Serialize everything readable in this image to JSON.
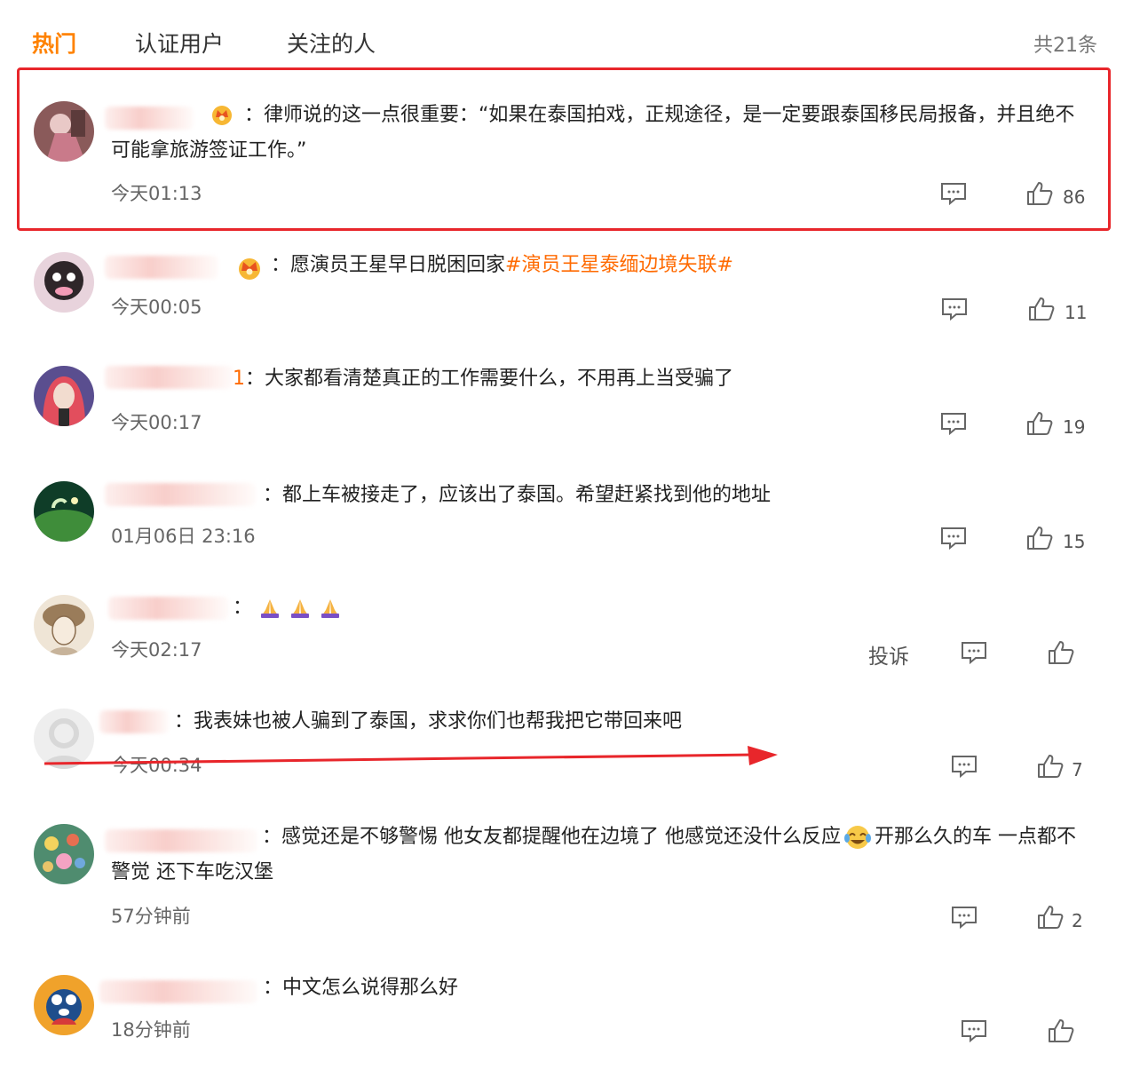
{
  "tabs": [
    {
      "label": "热门",
      "active": true
    },
    {
      "label": "认证用户",
      "active": false
    },
    {
      "label": "关注的人",
      "active": false
    }
  ],
  "total": "共21条",
  "comments": [
    {
      "colon": "：",
      "text": "律师说的这一点很重要：“如果在泰国拍戏，正规途径，是一定要跟泰国移民局报备，并且绝不可能拿旅游签证工作。”",
      "time": "今天01:13",
      "likes": "86"
    },
    {
      "colon": "：",
      "text": "愿演员王星早日脱困回家",
      "hashtag": "#演员王星泰缅边境失联#",
      "time": "今天00:05",
      "likes": "11"
    },
    {
      "name_tail": "1",
      "colon": "：",
      "text": "大家都看清楚真正的工作需要什么，不用再上当受骗了",
      "time": "今天00:17",
      "likes": "19"
    },
    {
      "colon": "：",
      "text": "都上车被接走了，应该出了泰国。希望赶紧找到他的地址",
      "time": "01月06日 23:16",
      "likes": "15"
    },
    {
      "colon": "：",
      "text": "",
      "emoji": "folded-hands-emoji",
      "time": "今天02:17",
      "likes": "",
      "report": "投诉"
    },
    {
      "colon": "：",
      "text": "我表妹也被人骗到了泰国，求求你们也帮我把它带回来吧",
      "time": "今天00:34",
      "likes": "7"
    },
    {
      "colon": "：",
      "text_a": "感觉还是不够警惕 他女友都提醒他在边境了 他感觉还没什么反应",
      "text_b": "开那么久的车 一点都不警觉 还下车吃汉堡",
      "time": "57分钟前",
      "likes": "2"
    },
    {
      "colon": "：",
      "text": "中文怎么说得那么好",
      "time": "18分钟前",
      "likes": ""
    }
  ],
  "colors": {
    "accent": "#ff8200",
    "hashtag": "#ff6a00",
    "annotation": "#e8262b"
  }
}
